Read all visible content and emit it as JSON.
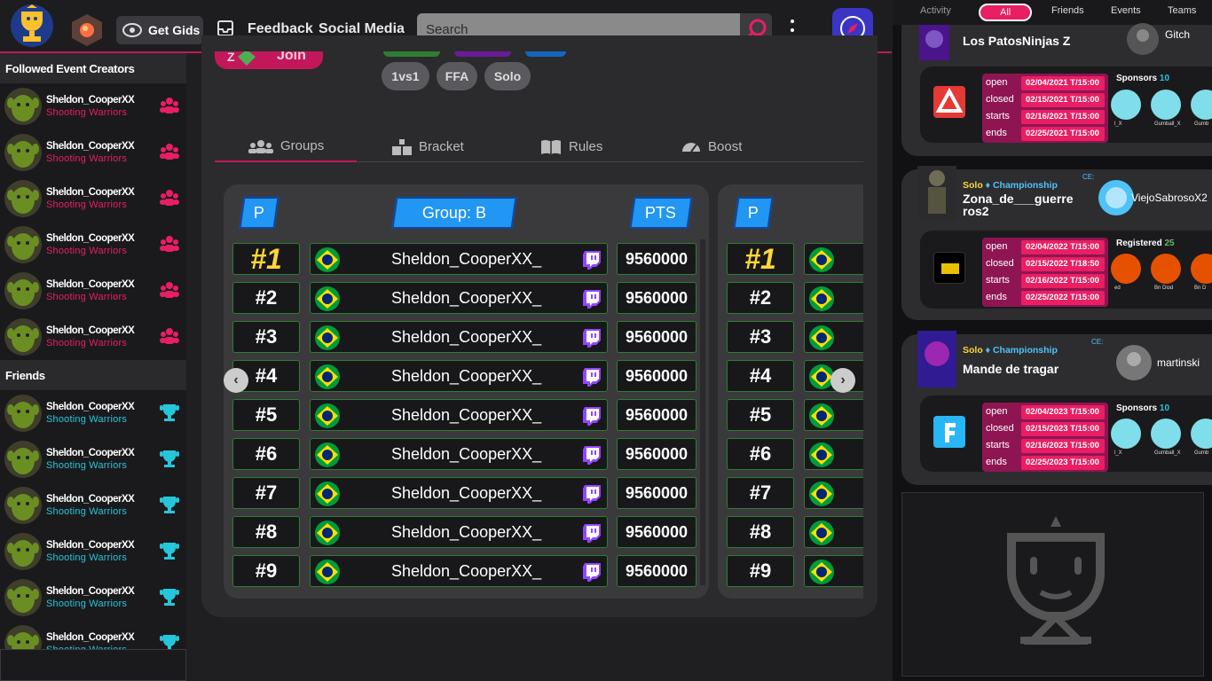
{
  "topbar": {
    "get_gids": "Get Gids",
    "feedback": "Feedback",
    "social_media": "Social Media",
    "search_placeholder": "Search"
  },
  "sidebar": {
    "followed_title": "Followed Event Creators",
    "followed": [
      {
        "name": "Sheldon_CooperXX",
        "sub": "Shooting Warriors"
      },
      {
        "name": "Sheldon_CooperXX",
        "sub": "Shooting Warriors"
      },
      {
        "name": "Sheldon_CooperXX",
        "sub": "Shooting Warriors"
      },
      {
        "name": "Sheldon_CooperXX",
        "sub": "Shooting Warriors"
      },
      {
        "name": "Sheldon_CooperXX",
        "sub": "Shooting Warriors"
      },
      {
        "name": "Sheldon_CooperXX",
        "sub": "Shooting Warriors"
      }
    ],
    "friends_title": "Friends",
    "friends": [
      {
        "name": "Sheldon_CooperXX",
        "sub": "Shooting Warriors"
      },
      {
        "name": "Sheldon_CooperXX",
        "sub": "Shooting Warriors"
      },
      {
        "name": "Sheldon_CooperXX",
        "sub": "Shooting Warriors"
      },
      {
        "name": "Sheldon_CooperXX",
        "sub": "Shooting Warriors"
      },
      {
        "name": "Sheldon_CooperXX",
        "sub": "Shooting Warriors"
      },
      {
        "name": "Sheldon_CooperXX",
        "sub": "Shooting Warriors"
      }
    ]
  },
  "event": {
    "join_label": "Join",
    "join_prefix": "Z",
    "pills": [
      "1vs1",
      "FFA",
      "Solo"
    ],
    "tabs": [
      "Groups",
      "Bracket",
      "Rules",
      "Boost"
    ],
    "group_b": {
      "pos_header": "P",
      "title": "Group: B",
      "pts_header": "PTS",
      "rows": [
        {
          "rank": "#1",
          "name": "Sheldon_CooperXX_",
          "pts": "9560000"
        },
        {
          "rank": "#2",
          "name": "Sheldon_CooperXX_",
          "pts": "9560000"
        },
        {
          "rank": "#3",
          "name": "Sheldon_CooperXX_",
          "pts": "9560000"
        },
        {
          "rank": "#4",
          "name": "Sheldon_CooperXX_",
          "pts": "9560000"
        },
        {
          "rank": "#5",
          "name": "Sheldon_CooperXX_",
          "pts": "9560000"
        },
        {
          "rank": "#6",
          "name": "Sheldon_CooperXX_",
          "pts": "9560000"
        },
        {
          "rank": "#7",
          "name": "Sheldon_CooperXX_",
          "pts": "9560000"
        },
        {
          "rank": "#8",
          "name": "Sheldon_CooperXX_",
          "pts": "9560000"
        },
        {
          "rank": "#9",
          "name": "Sheldon_CooperXX_",
          "pts": "9560000"
        }
      ]
    },
    "group_next": {
      "pos_header": "P",
      "ranks": [
        "#1",
        "#2",
        "#3",
        "#4",
        "#5",
        "#6",
        "#7",
        "#8",
        "#9"
      ]
    }
  },
  "activity": {
    "tabs": [
      "Activity",
      "All",
      "Friends",
      "Events",
      "Teams"
    ],
    "active_tab": "All",
    "cards": [
      {
        "title": "Los PatosNinjas Z",
        "host": "Gitch",
        "dates": [
          {
            "label": "open",
            "value": "02/04/2021 T/15:00"
          },
          {
            "label": "closed",
            "value": "02/15/2021 T/15:00"
          },
          {
            "label": "starts",
            "value": "02/16/2021 T/15:00"
          },
          {
            "label": "ends",
            "value": "02/25/2021 T/15:00"
          }
        ],
        "sponsor_label": "Sponsors",
        "sponsor_count": "10",
        "sponsor_names": [
          "l_X",
          "Gumball_X",
          "Gumb"
        ]
      },
      {
        "type_a": "Solo",
        "type_b": "Championship",
        "ce": "CE:",
        "title_line1": "Zona_de___guerre",
        "title_line2": "ros2",
        "host": "ViejoSabrosoX2",
        "dates": [
          {
            "label": "open",
            "value": "02/04/2022 T/15:00"
          },
          {
            "label": "closed",
            "value": "02/15/2022 T/18:50"
          },
          {
            "label": "starts",
            "value": "02/16/2022 T/15:00"
          },
          {
            "label": "ends",
            "value": "02/25/2022 T/15:00"
          }
        ],
        "sponsor_label": "Registered",
        "sponsor_count": "25",
        "sponsor_names": [
          "ed",
          "Bn Diod",
          "Bn D"
        ]
      },
      {
        "type_a": "Solo",
        "type_b": "Championship",
        "ce": "CE:",
        "title": "Mande de tragar",
        "host": "martinski",
        "dates": [
          {
            "label": "open",
            "value": "02/04/2023 T/15:00"
          },
          {
            "label": "closed",
            "value": "02/15/2023 T/15:00"
          },
          {
            "label": "starts",
            "value": "02/16/2023 T/15:00"
          },
          {
            "label": "ends",
            "value": "02/25/2023 T/15:00"
          }
        ],
        "sponsor_label": "Sponsors",
        "sponsor_count": "10",
        "sponsor_names": [
          "l_X",
          "Gumball_X",
          "Gumb"
        ]
      }
    ]
  },
  "colors": {
    "accent": "#c2185b",
    "pink": "#e91e63",
    "blue": "#2196f3",
    "green_border": "#2e7d32",
    "gold": "#fdd835",
    "teal": "#26c6da"
  }
}
